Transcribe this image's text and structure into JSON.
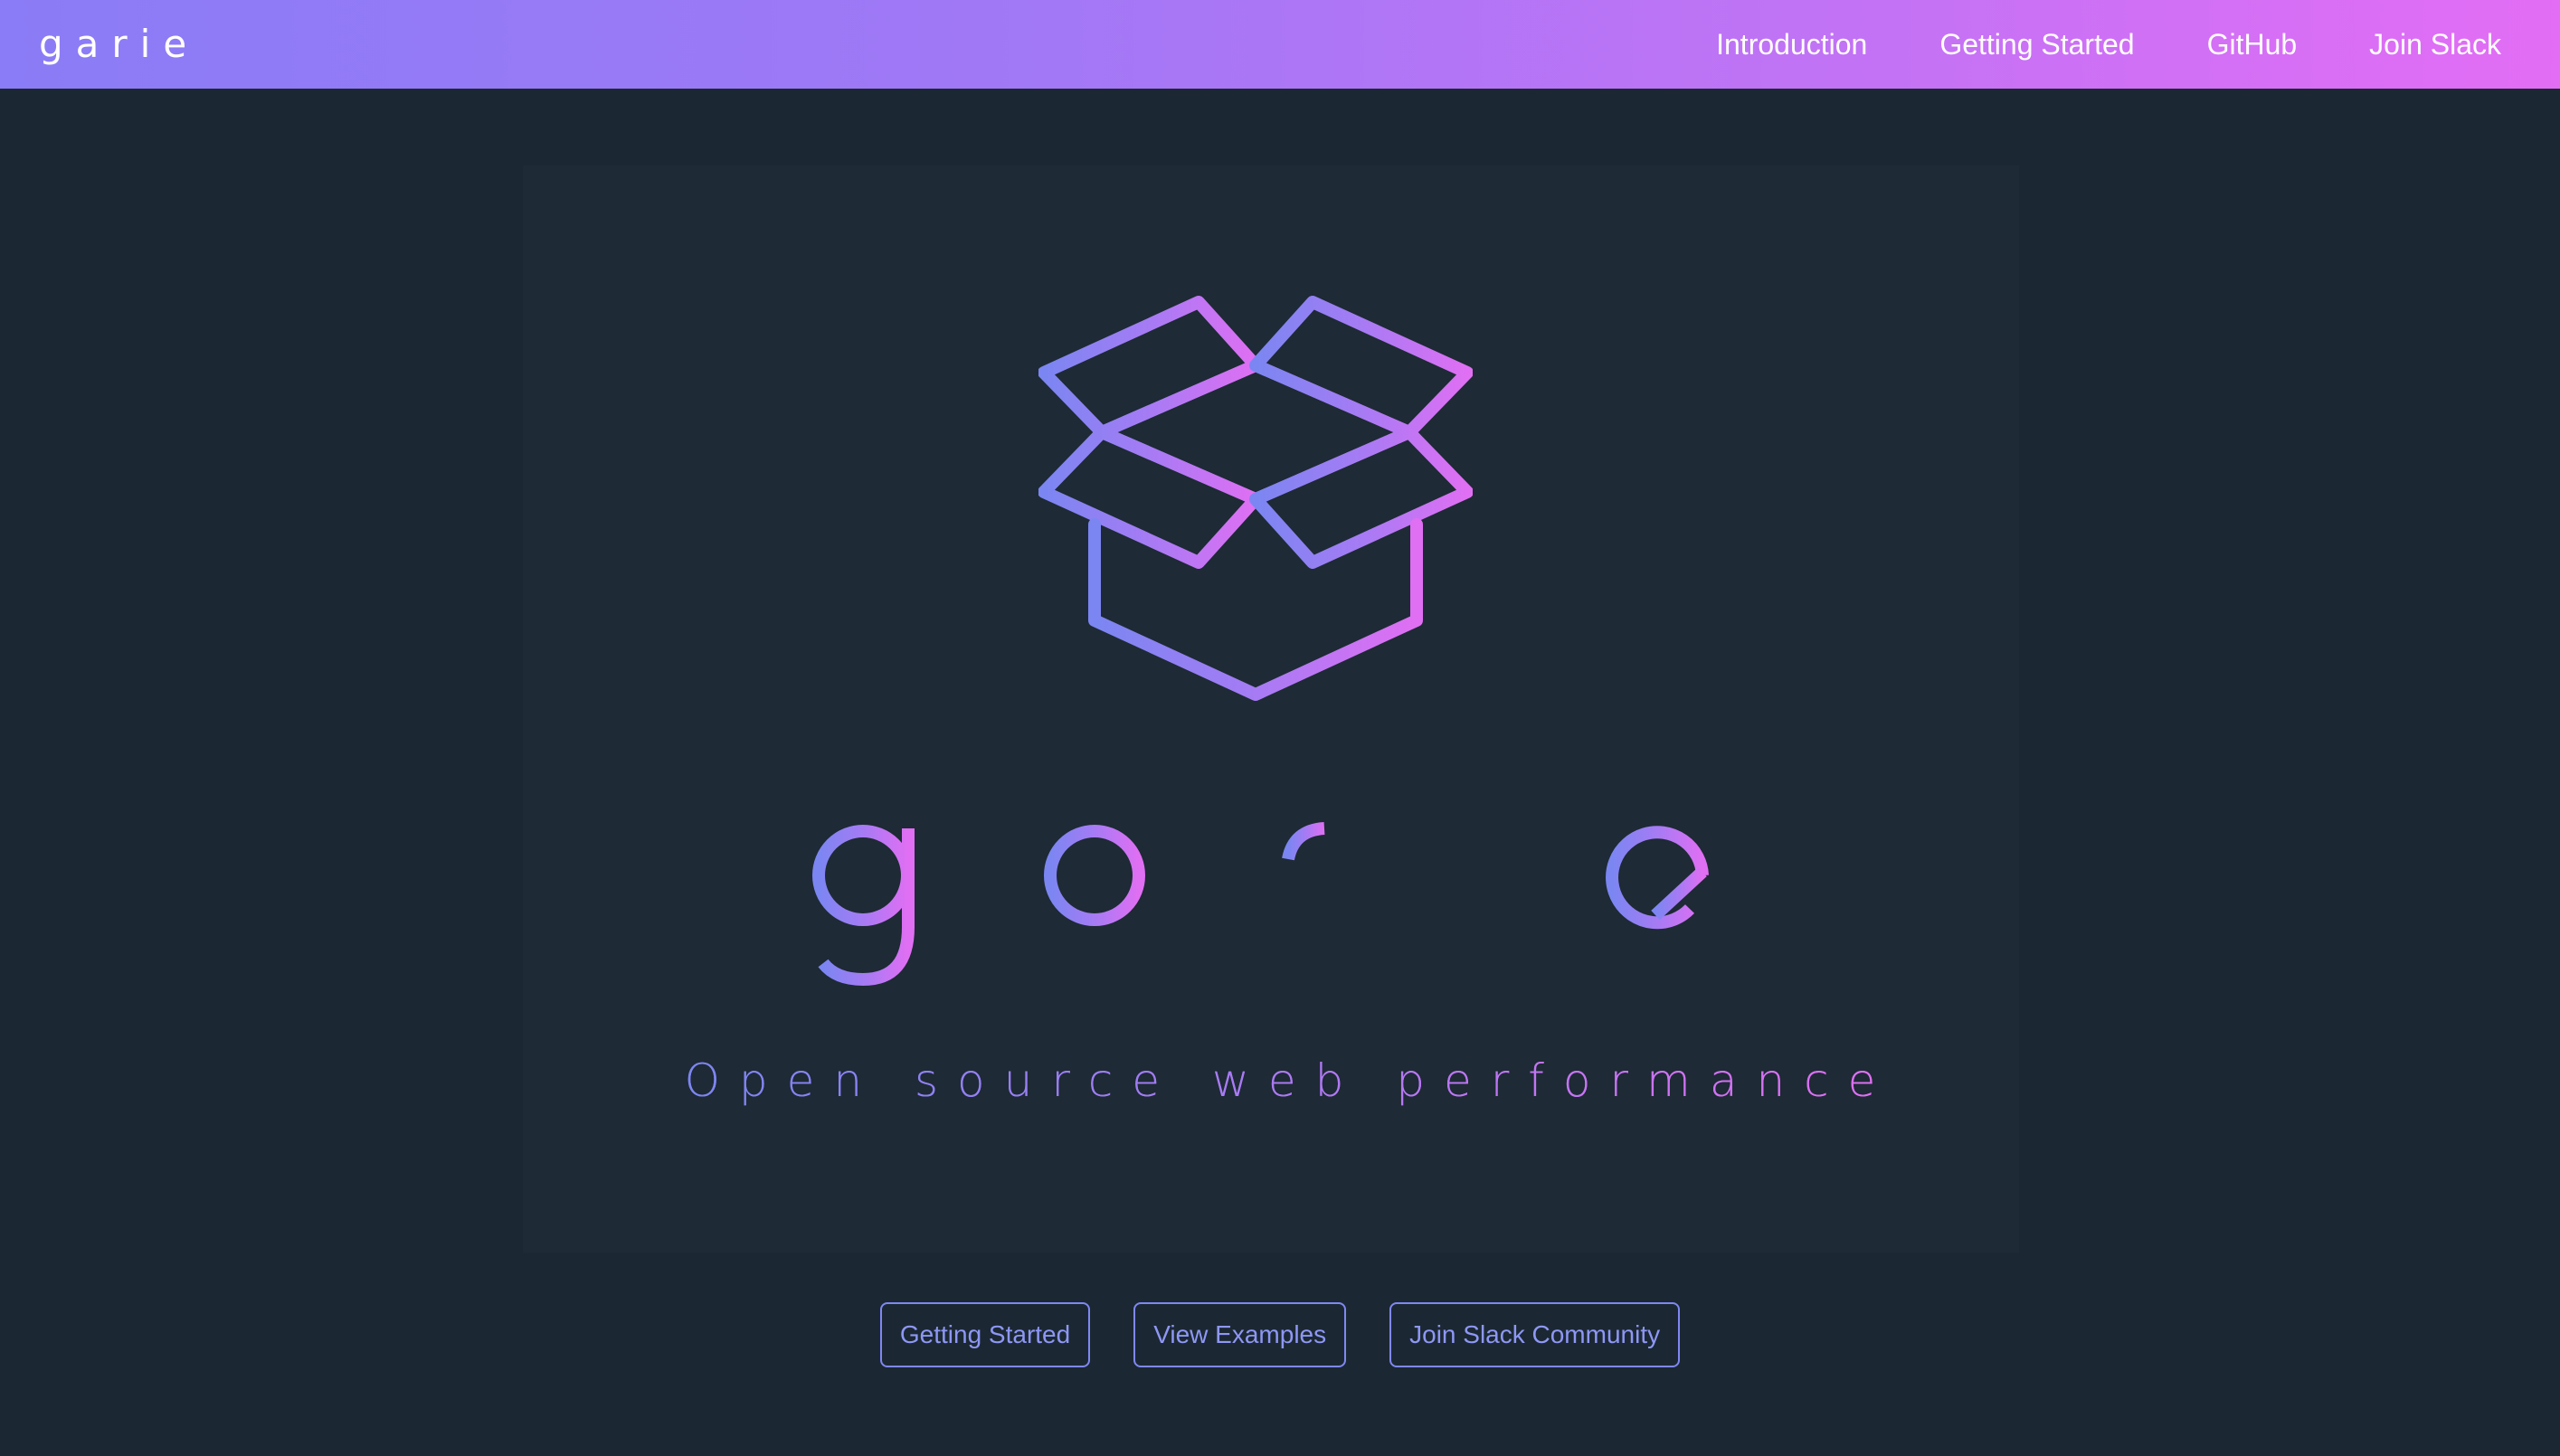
{
  "header": {
    "brand": "garie",
    "nav": [
      {
        "label": "Introduction"
      },
      {
        "label": "Getting Started"
      },
      {
        "label": "GitHub"
      },
      {
        "label": "Join Slack"
      }
    ]
  },
  "hero": {
    "logo_icon": "open-box-icon",
    "wordmark": "garie",
    "tagline": "Open source web performance"
  },
  "actions": [
    {
      "label": "Getting Started"
    },
    {
      "label": "View Examples"
    },
    {
      "label": "Join Slack Community"
    }
  ],
  "colors": {
    "header_gradient_start": "#8a7cf6",
    "header_gradient_end": "#e36df5",
    "background": "#1b2833",
    "panel": "#1e2a35",
    "accent_blue": "#7b86f2",
    "accent_pink": "#e06ff3"
  }
}
